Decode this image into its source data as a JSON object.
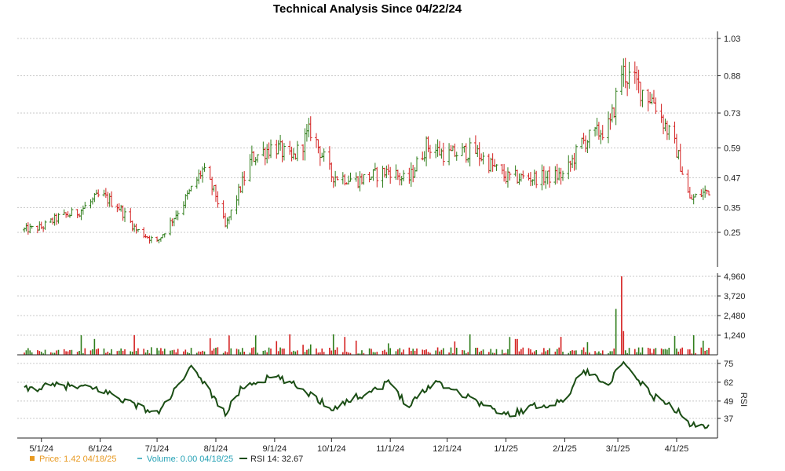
{
  "chart_data": {
    "type": "financial",
    "title": "Technical Analysis Since 04/22/24",
    "x_ticks": [
      "5/1/24",
      "6/1/24",
      "7/1/24",
      "8/1/24",
      "9/1/24",
      "10/1/24",
      "11/1/24",
      "12/1/24",
      "1/1/25",
      "2/1/25",
      "3/1/25",
      "4/1/25"
    ],
    "price_panel": {
      "type": "ohlc",
      "yticks": [
        "1.03",
        "0.88",
        "0.73",
        "0.59",
        "0.47",
        "0.35",
        "0.25"
      ],
      "ylim": [
        0.13,
        1.05
      ],
      "grid": true,
      "up_color": "#2e7d1a",
      "down_color": "#d42020",
      "key_points": [
        {
          "date": "04/22/24",
          "close": 0.26
        },
        {
          "date": "05/01/24",
          "close": 0.27
        },
        {
          "date": "05/10/24",
          "close": 0.31
        },
        {
          "date": "05/20/24",
          "close": 0.33
        },
        {
          "date": "06/01/24",
          "close": 0.4
        },
        {
          "date": "06/10/24",
          "close": 0.36
        },
        {
          "date": "06/20/24",
          "close": 0.26
        },
        {
          "date": "07/01/24",
          "close": 0.21
        },
        {
          "date": "07/15/24",
          "close": 0.37
        },
        {
          "date": "07/25/24",
          "close": 0.5
        },
        {
          "date": "08/01/24",
          "close": 0.4
        },
        {
          "date": "08/06/24",
          "close": 0.27
        },
        {
          "date": "08/20/24",
          "close": 0.55
        },
        {
          "date": "09/01/24",
          "close": 0.6
        },
        {
          "date": "09/10/24",
          "close": 0.54
        },
        {
          "date": "09/20/24",
          "close": 0.66
        },
        {
          "date": "10/01/24",
          "close": 0.48
        },
        {
          "date": "10/15/24",
          "close": 0.46
        },
        {
          "date": "11/01/24",
          "close": 0.5
        },
        {
          "date": "11/10/24",
          "close": 0.45
        },
        {
          "date": "11/20/24",
          "close": 0.6
        },
        {
          "date": "12/01/24",
          "close": 0.56
        },
        {
          "date": "12/15/24",
          "close": 0.58
        },
        {
          "date": "01/01/25",
          "close": 0.47
        },
        {
          "date": "01/20/25",
          "close": 0.47
        },
        {
          "date": "02/01/25",
          "close": 0.48
        },
        {
          "date": "02/10/25",
          "close": 0.61
        },
        {
          "date": "02/25/25",
          "close": 0.68
        },
        {
          "date": "03/03/25",
          "close": 0.9
        },
        {
          "date": "03/10/25",
          "close": 0.85
        },
        {
          "date": "03/20/25",
          "close": 0.78
        },
        {
          "date": "04/01/25",
          "close": 0.58
        },
        {
          "date": "04/08/25",
          "close": 0.38
        },
        {
          "date": "04/18/25",
          "close": 0.42
        }
      ]
    },
    "volume_panel": {
      "yticks": [
        "4,960",
        "3,720",
        "2,480",
        "1,240"
      ],
      "ylim": [
        0,
        5000
      ],
      "grid": true,
      "spikes": [
        {
          "date": "03/01/25",
          "value": 2900
        },
        {
          "date": "03/03/25",
          "value": 4960
        },
        {
          "date": "03/05/25",
          "value": 1500
        }
      ],
      "typical_value": 400
    },
    "rsi_panel": {
      "label": "RSI",
      "yticks": [
        "75",
        "62",
        "49",
        "37"
      ],
      "ylim": [
        27,
        77
      ],
      "color": "#1a4d14",
      "key_points": [
        {
          "date": "04/22/24",
          "value": 57
        },
        {
          "date": "05/10/24",
          "value": 60
        },
        {
          "date": "06/01/24",
          "value": 57
        },
        {
          "date": "06/15/24",
          "value": 49
        },
        {
          "date": "07/01/24",
          "value": 40
        },
        {
          "date": "07/20/24",
          "value": 73
        },
        {
          "date": "08/06/24",
          "value": 40
        },
        {
          "date": "08/15/24",
          "value": 59
        },
        {
          "date": "09/01/24",
          "value": 66
        },
        {
          "date": "09/15/24",
          "value": 58
        },
        {
          "date": "10/01/24",
          "value": 44
        },
        {
          "date": "11/01/24",
          "value": 62
        },
        {
          "date": "11/10/24",
          "value": 46
        },
        {
          "date": "11/25/24",
          "value": 63
        },
        {
          "date": "12/15/24",
          "value": 50
        },
        {
          "date": "01/01/25",
          "value": 39
        },
        {
          "date": "01/15/25",
          "value": 45
        },
        {
          "date": "02/01/25",
          "value": 49
        },
        {
          "date": "02/10/25",
          "value": 70
        },
        {
          "date": "02/25/25",
          "value": 62
        },
        {
          "date": "03/03/25",
          "value": 75
        },
        {
          "date": "03/20/25",
          "value": 52
        },
        {
          "date": "04/01/25",
          "value": 43
        },
        {
          "date": "04/08/25",
          "value": 32
        },
        {
          "date": "04/18/25",
          "value": 32.67
        }
      ]
    },
    "legend": [
      {
        "label": "Price: 1.42  04/18/25",
        "color": "#e89a22",
        "marker": "square"
      },
      {
        "label": "Volume: 0.00  04/18/25",
        "color": "#22a0b4",
        "marker": "dash"
      },
      {
        "label": "RSI 14: 32.67",
        "color": "#1a4d14",
        "marker": "line"
      }
    ]
  }
}
